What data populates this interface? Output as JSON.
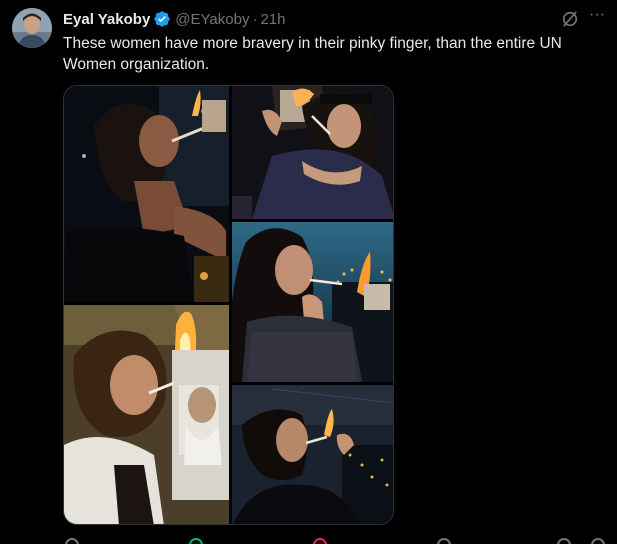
{
  "tweet": {
    "author_name": "Eyal Yakoby",
    "handle": "@EYakoby",
    "separator": "·",
    "time": "21h",
    "text": "These women have more bravery in their pinky finger, than the entire UN Women organization.",
    "more_label": "···"
  },
  "icons": {
    "verified": "verified-badge-icon",
    "grok": "grok-icon",
    "more": "more-icon"
  },
  "media": {
    "photo_count": 5
  },
  "colors": {
    "background": "#000000",
    "text": "#e7e9ea",
    "secondary": "#71767b",
    "verified": "#1d9bf0",
    "retweet": "#00ba7c",
    "like": "#f91880"
  }
}
